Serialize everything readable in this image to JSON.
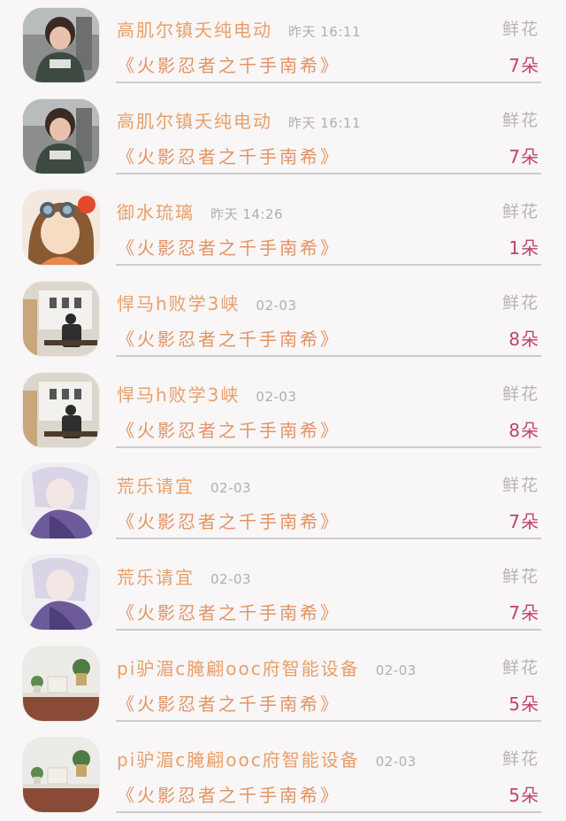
{
  "colors": {
    "name": "#e8a06a",
    "time": "#b3adb0",
    "work": "#e29464",
    "gift_label": "#b9b3b6",
    "gift_count": "#c14466",
    "divider": "#cfcacc",
    "background": "#f8f6f7"
  },
  "list": {
    "items": [
      {
        "avatar": "child-photo-avatar",
        "name": "高肌尔镇夭纯电动",
        "time": "昨天 16:11",
        "work": "《火影忍者之千手南希》",
        "gift_label": "鲜花",
        "gift_count": "7朵"
      },
      {
        "avatar": "child-photo-avatar",
        "name": "高肌尔镇夭纯电动",
        "time": "昨天 16:11",
        "work": "《火影忍者之千手南希》",
        "gift_label": "鲜花",
        "gift_count": "7朵"
      },
      {
        "avatar": "anime-girl-avatar",
        "name": "御水琉璃",
        "time": "昨天 14:26",
        "work": "《火影忍者之千手南希》",
        "gift_label": "鲜花",
        "gift_count": "1朵"
      },
      {
        "avatar": "window-scene-avatar",
        "name": "悍马h败学3峡",
        "time": "02-03",
        "work": "《火影忍者之千手南希》",
        "gift_label": "鲜花",
        "gift_count": "8朵"
      },
      {
        "avatar": "window-scene-avatar",
        "name": "悍马h败学3峡",
        "time": "02-03",
        "work": "《火影忍者之千手南希》",
        "gift_label": "鲜花",
        "gift_count": "8朵"
      },
      {
        "avatar": "anime-boy-avatar",
        "name": "荒乐请宜",
        "time": "02-03",
        "work": "《火影忍者之千手南希》",
        "gift_label": "鲜花",
        "gift_count": "7朵"
      },
      {
        "avatar": "anime-boy-avatar",
        "name": "荒乐请宜",
        "time": "02-03",
        "work": "《火影忍者之千手南希》",
        "gift_label": "鲜花",
        "gift_count": "7朵"
      },
      {
        "avatar": "plant-shelf-avatar",
        "name": "pi驴湄c腌翩ooc府智能设备",
        "time": "02-03",
        "work": "《火影忍者之千手南希》",
        "gift_label": "鲜花",
        "gift_count": "5朵"
      },
      {
        "avatar": "plant-shelf-avatar",
        "name": "pi驴湄c腌翩ooc府智能设备",
        "time": "02-03",
        "work": "《火影忍者之千手南希》",
        "gift_label": "鲜花",
        "gift_count": "5朵"
      }
    ]
  }
}
